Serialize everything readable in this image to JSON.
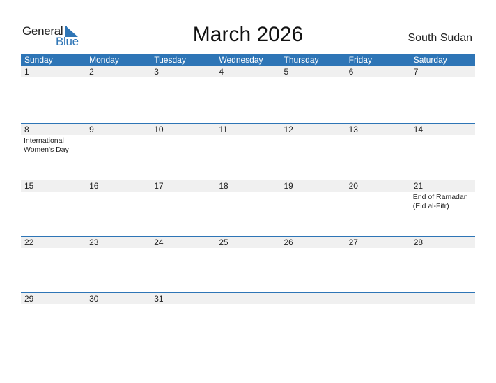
{
  "logo": {
    "line1": "General",
    "line2": "Blue"
  },
  "header": {
    "title": "March 2026",
    "country": "South Sudan"
  },
  "colors": {
    "accent": "#2e75b6",
    "date_strip": "#f0f0f0"
  },
  "weekdays": [
    "Sunday",
    "Monday",
    "Tuesday",
    "Wednesday",
    "Thursday",
    "Friday",
    "Saturday"
  ],
  "weeks": [
    [
      {
        "date": "1",
        "event": ""
      },
      {
        "date": "2",
        "event": ""
      },
      {
        "date": "3",
        "event": ""
      },
      {
        "date": "4",
        "event": ""
      },
      {
        "date": "5",
        "event": ""
      },
      {
        "date": "6",
        "event": ""
      },
      {
        "date": "7",
        "event": ""
      }
    ],
    [
      {
        "date": "8",
        "event": "International Women's Day"
      },
      {
        "date": "9",
        "event": ""
      },
      {
        "date": "10",
        "event": ""
      },
      {
        "date": "11",
        "event": ""
      },
      {
        "date": "12",
        "event": ""
      },
      {
        "date": "13",
        "event": ""
      },
      {
        "date": "14",
        "event": ""
      }
    ],
    [
      {
        "date": "15",
        "event": ""
      },
      {
        "date": "16",
        "event": ""
      },
      {
        "date": "17",
        "event": ""
      },
      {
        "date": "18",
        "event": ""
      },
      {
        "date": "19",
        "event": ""
      },
      {
        "date": "20",
        "event": ""
      },
      {
        "date": "21",
        "event": "End of Ramadan (Eid al-Fitr)"
      }
    ],
    [
      {
        "date": "22",
        "event": ""
      },
      {
        "date": "23",
        "event": ""
      },
      {
        "date": "24",
        "event": ""
      },
      {
        "date": "25",
        "event": ""
      },
      {
        "date": "26",
        "event": ""
      },
      {
        "date": "27",
        "event": ""
      },
      {
        "date": "28",
        "event": ""
      }
    ],
    [
      {
        "date": "29",
        "event": ""
      },
      {
        "date": "30",
        "event": ""
      },
      {
        "date": "31",
        "event": ""
      },
      {
        "date": "",
        "event": ""
      },
      {
        "date": "",
        "event": ""
      },
      {
        "date": "",
        "event": ""
      },
      {
        "date": "",
        "event": ""
      }
    ]
  ]
}
